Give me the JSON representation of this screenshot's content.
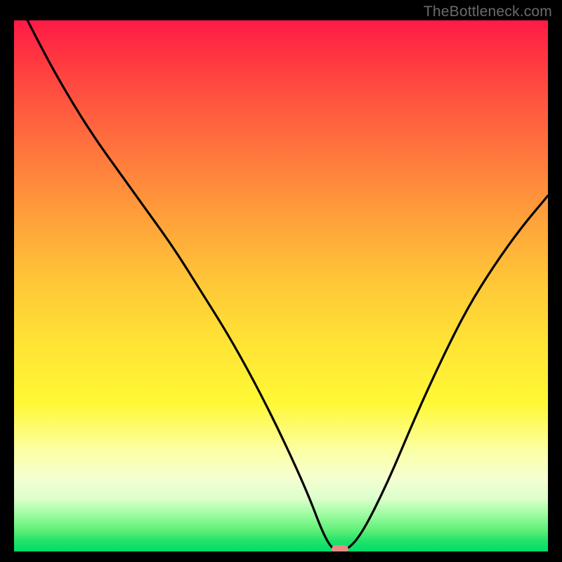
{
  "watermark": "TheBottleneck.com",
  "colors": {
    "frame": "#000000",
    "curve": "#000000",
    "marker": "#e78b87",
    "gradient_top": "#ff1a47",
    "gradient_bottom": "#00dd69"
  },
  "chart_data": {
    "type": "line",
    "title": "",
    "xlabel": "",
    "ylabel": "",
    "xlim": [
      0,
      100
    ],
    "ylim": [
      0,
      100
    ],
    "x": [
      0,
      5,
      10,
      15,
      20,
      25,
      30,
      35,
      40,
      45,
      50,
      55,
      58,
      60,
      62,
      65,
      70,
      75,
      80,
      85,
      90,
      95,
      100
    ],
    "values": [
      105,
      95,
      86,
      78,
      71,
      64,
      57,
      49,
      41,
      32,
      22,
      11,
      3,
      0,
      0,
      3,
      13,
      25,
      36,
      46,
      54,
      61,
      67
    ],
    "marker": {
      "x": 61,
      "y": 0
    },
    "notes": "Bottleneck-style V curve; y-axis values are relative bottleneck percentage, x-axis is component balance. Axes have no visible tick labels."
  }
}
